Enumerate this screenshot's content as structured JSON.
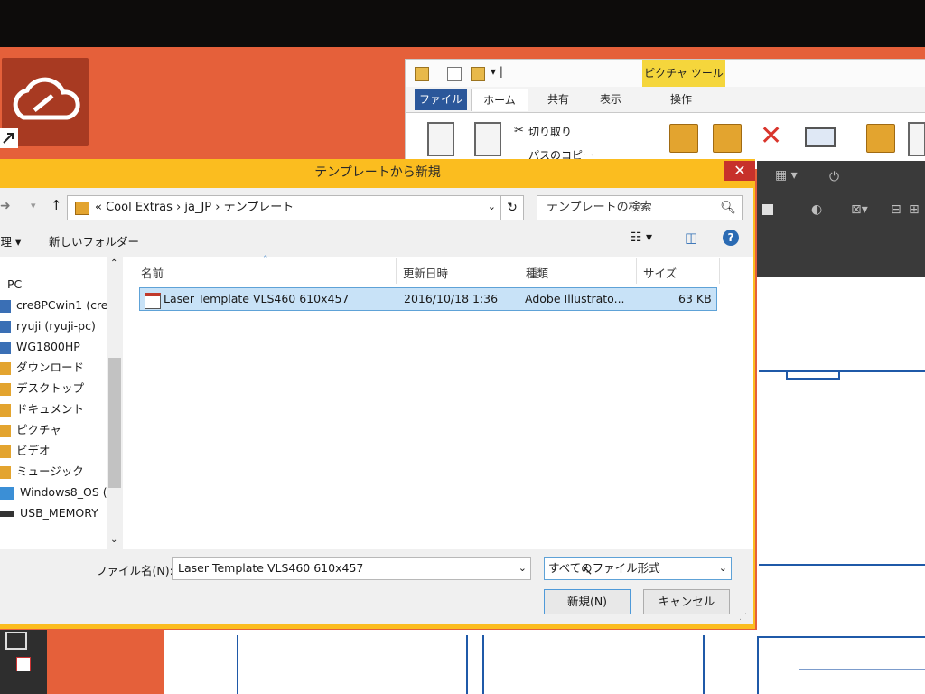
{
  "explorer": {
    "context_tab": "ピクチャ ツール",
    "tabs": [
      "ファイル",
      "ホーム",
      "共有",
      "表示",
      "操作"
    ],
    "cut_label": "切り取り",
    "copy_path_label": "パスのコピー"
  },
  "dialog": {
    "title": "テンプレートから新規",
    "close_glyph": "✕",
    "breadcrumb": "«  Cool Extras  ›  ja_JP  ›  テンプレート",
    "search_placeholder": "テンプレートの検索",
    "organize_label": "整理 ▾",
    "new_folder_label": "新しいフォルダー",
    "nav_items": [
      "PC",
      "cre8PCwin1 (cre",
      "ryuji (ryuji-pc)",
      "WG1800HP",
      "ダウンロード",
      "デスクトップ",
      "ドキュメント",
      "ピクチャ",
      "ビデオ",
      "ミュージック",
      "Windows8_OS (",
      "USB_MEMORY"
    ],
    "columns": {
      "name": "名前",
      "date": "更新日時",
      "type": "種類",
      "size": "サイズ"
    },
    "files": [
      {
        "name": "Laser Template VLS460 610x457",
        "date": "2016/10/18 1:36",
        "type": "Adobe Illustrato...",
        "size": "63 KB"
      }
    ],
    "filename_label": "ファイル名(N):",
    "filename_value": "Laser Template VLS460 610x457",
    "filetype_value": "すべてのファイル形式",
    "new_button": "新規(N)",
    "cancel_button": "キャンセル"
  },
  "colors": {
    "desktop": "#e5603a",
    "dialog_frame": "#fbbd1f",
    "selection": "#c8e2f7",
    "close_button": "#c7312b",
    "explorer_file_tab": "#2b579a",
    "context_tab": "#f5d63c"
  }
}
